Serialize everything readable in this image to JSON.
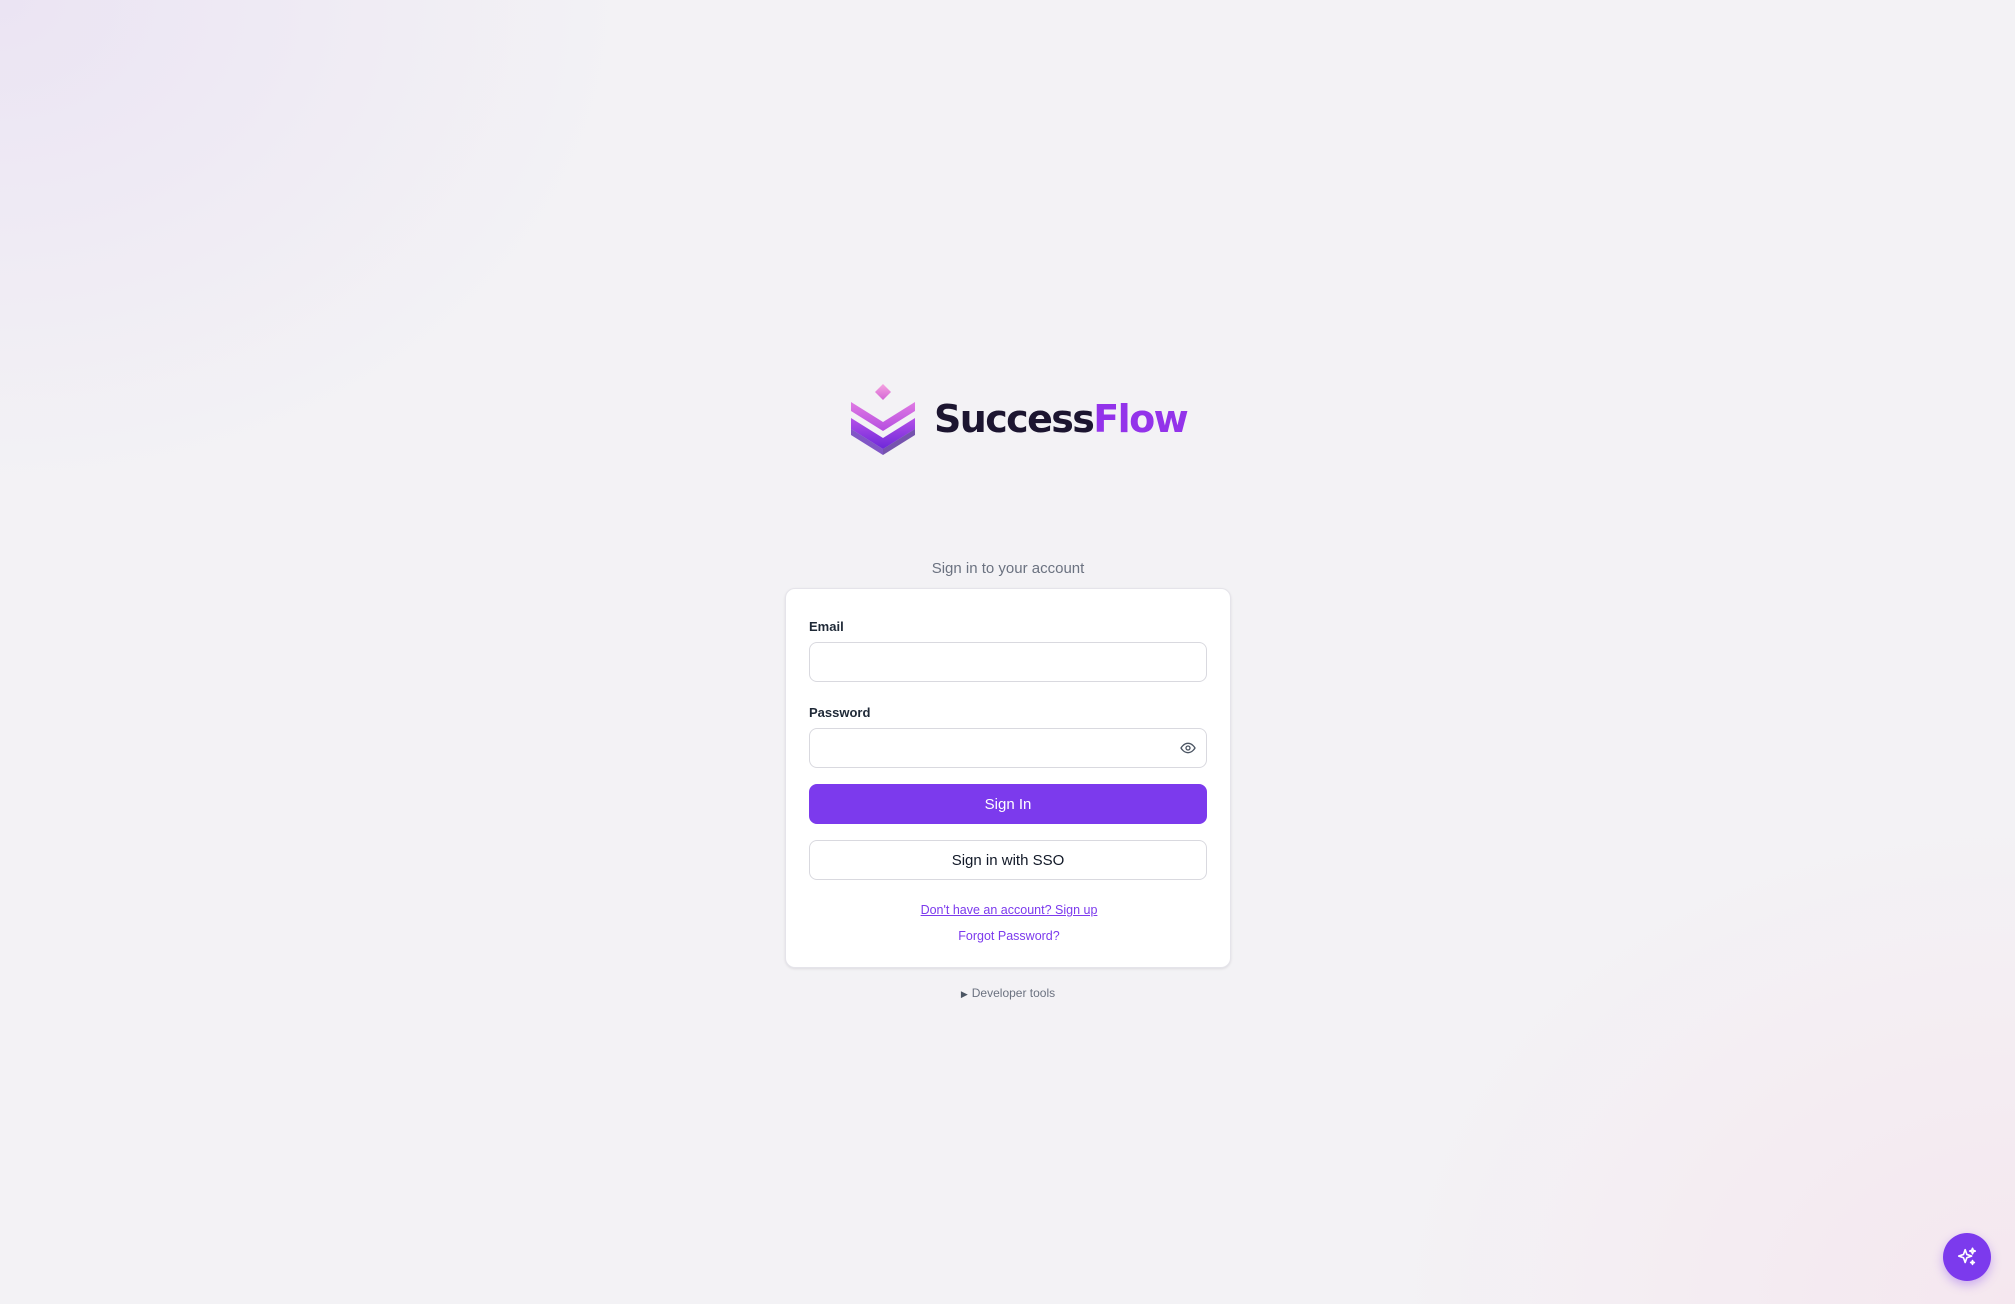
{
  "brand": {
    "name_part1": "Success",
    "name_part2": "Flow",
    "colors": {
      "primary": "#7c3aed",
      "wordmark_dark": "#1c1530",
      "wordmark_accent": "#9333ea"
    }
  },
  "auth": {
    "subtitle": "Sign in to your account",
    "email_label": "Email",
    "email_value": "",
    "password_label": "Password",
    "password_value": "",
    "password_toggle_icon": "eye-icon",
    "sign_in_label": "Sign In",
    "sso_label": "Sign in with SSO",
    "signup_link": "Don't have an account? Sign up",
    "forgot_link": "Forgot Password?"
  },
  "dev_tools": {
    "caret": "▶",
    "label": "Developer tools"
  },
  "assistant_button": {
    "icon": "sparkles-icon"
  }
}
